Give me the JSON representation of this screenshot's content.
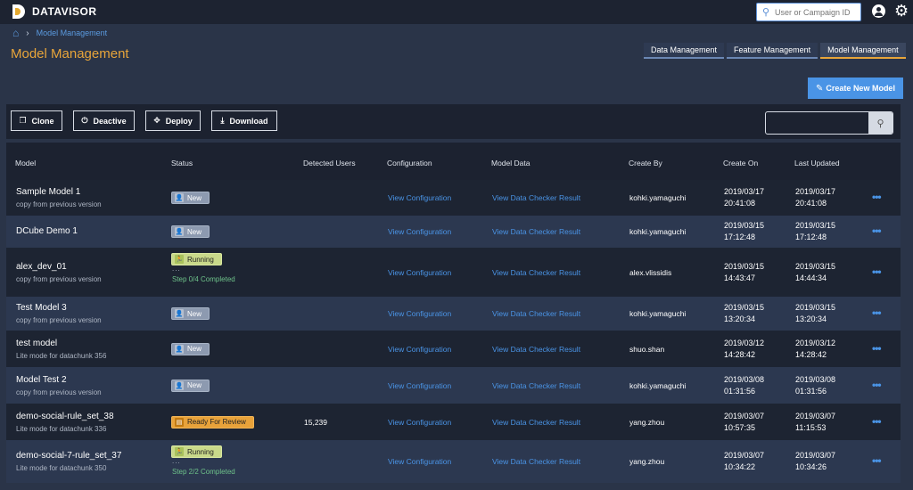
{
  "app": {
    "brand": "DATAVISOR"
  },
  "search": {
    "placeholder": "User or Campaign ID"
  },
  "breadcrumb": {
    "current": "Model Management"
  },
  "page": {
    "title": "Model Management"
  },
  "tabs": [
    {
      "label": "Data Management"
    },
    {
      "label": "Feature Management"
    },
    {
      "label": "Model Management",
      "active": true
    }
  ],
  "actions": {
    "create": "Create New Model"
  },
  "toolbar": {
    "clone": "Clone",
    "deactive": "Deactive",
    "deploy": "Deploy",
    "download": "Download"
  },
  "table": {
    "headers": [
      "Model",
      "Status",
      "Detected Users",
      "Configuration",
      "Model Data",
      "Create By",
      "Create On",
      "Last Updated"
    ],
    "rows": [
      {
        "name": "Sample Model 1",
        "sub": "copy from previous version",
        "status": "New",
        "detected": "",
        "config": "View Configuration",
        "data": "View Data Checker Result",
        "by": "kohki.yamaguchi",
        "created_date": "2019/03/17",
        "created_time": "20:41:08",
        "updated_date": "2019/03/17",
        "updated_time": "20:41:08"
      },
      {
        "name": "DCube Demo 1",
        "sub": "",
        "status": "New",
        "detected": "",
        "config": "View Configuration",
        "data": "View Data Checker Result",
        "by": "kohki.yamaguchi",
        "created_date": "2019/03/15",
        "created_time": "17:12:48",
        "updated_date": "2019/03/15",
        "updated_time": "17:12:48"
      },
      {
        "name": "alex_dev_01",
        "sub": "copy from previous version",
        "status": "Running",
        "dots": "...",
        "step": "Step 0/4 Completed",
        "detected": "",
        "config": "View Configuration",
        "data": "View Data Checker Result",
        "by": "alex.vlissidis",
        "created_date": "2019/03/15",
        "created_time": "14:43:47",
        "updated_date": "2019/03/15",
        "updated_time": "14:44:34"
      },
      {
        "name": "Test Model 3",
        "sub": "copy from previous version",
        "status": "New",
        "detected": "",
        "config": "View Configuration",
        "data": "View Data Checker Result",
        "by": "kohki.yamaguchi",
        "created_date": "2019/03/15",
        "created_time": "13:20:34",
        "updated_date": "2019/03/15",
        "updated_time": "13:20:34"
      },
      {
        "name": "test model",
        "sub": "Lite mode for datachunk 356",
        "status": "New",
        "detected": "",
        "config": "View Configuration",
        "data": "View Data Checker Result",
        "by": "shuo.shan",
        "created_date": "2019/03/12",
        "created_time": "14:28:42",
        "updated_date": "2019/03/12",
        "updated_time": "14:28:42"
      },
      {
        "name": "Model Test 2",
        "sub": "copy from previous version",
        "status": "New",
        "detected": "",
        "config": "View Configuration",
        "data": "View Data Checker Result",
        "by": "kohki.yamaguchi",
        "created_date": "2019/03/08",
        "created_time": "01:31:56",
        "updated_date": "2019/03/08",
        "updated_time": "01:31:56"
      },
      {
        "name": "demo-social-rule_set_38",
        "sub": "Lite mode for datachunk 336",
        "status": "Ready For Review",
        "detected": "15,239",
        "config": "View Configuration",
        "data": "View Data Checker Result",
        "by": "yang.zhou",
        "created_date": "2019/03/07",
        "created_time": "10:57:35",
        "updated_date": "2019/03/07",
        "updated_time": "11:15:53"
      },
      {
        "name": "demo-social-7-rule_set_37",
        "sub": "Lite mode for datachunk 350",
        "status": "Running",
        "dots": "...",
        "step": "Step 2/2 Completed",
        "detected": "",
        "config": "View Configuration",
        "data": "View Data Checker Result",
        "by": "yang.zhou",
        "created_date": "2019/03/07",
        "created_time": "10:34:22",
        "updated_date": "2019/03/07",
        "updated_time": "10:34:26"
      }
    ]
  }
}
